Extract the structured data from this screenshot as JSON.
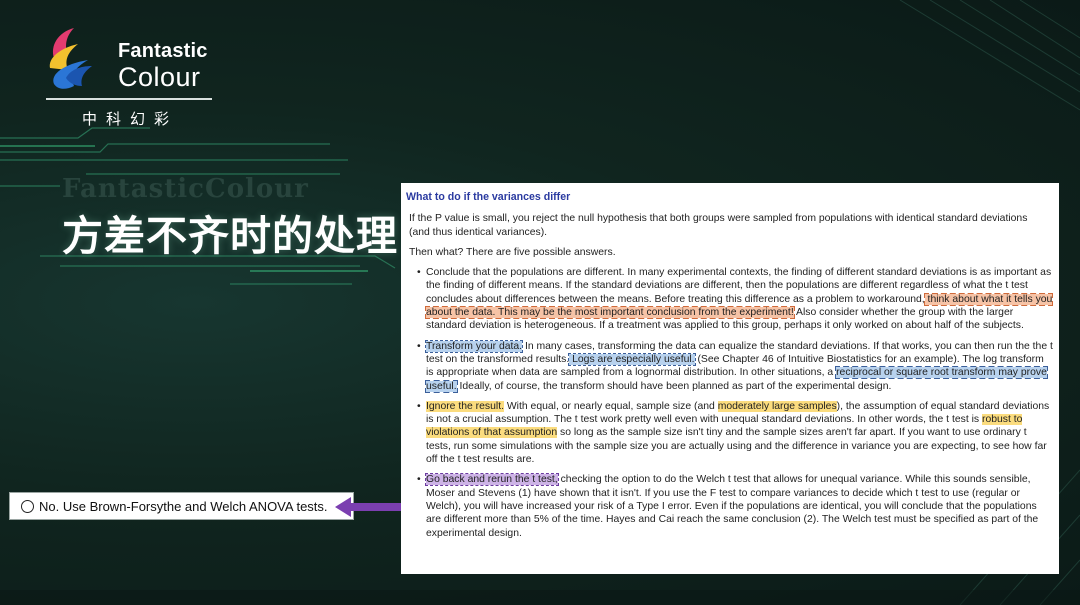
{
  "logo": {
    "name_line1": "Fantastic",
    "name_line2": "Colour",
    "name_cn": "中科幻彩"
  },
  "slide": {
    "ghost_text": "FantasticColour",
    "title": "方差不齐时的处理"
  },
  "note": {
    "text": "No. Use Brown-Forsythe and Welch ANOVA tests."
  },
  "panel": {
    "heading": "What to do if the variances differ",
    "para1": "If the P value is small, you reject the null hypothesis that both groups were sampled from populations with identical standard deviations (and thus identical variances).",
    "para2": "Then what? There are five possible answers.",
    "bullet": "•",
    "item1": {
      "t1": "Conclude that the populations are different. In many experimental contexts, the finding of different standard deviations is as important as the finding of different means. If the standard deviations are different, then the populations are different regardless of what the t test concludes about differences between the means. Before treating this difference as a problem to workaround,",
      "h1": " think about what it tells you about the data. This may be the most important conclusion from the experiment!",
      "t2": " Also consider whether the group with the larger standard deviation is heterogeneous. If a treatment was applied to this group, perhaps it only worked on about half of the subjects."
    },
    "item2": {
      "h1": "Transform your data.",
      "t1": " In many cases, transforming the data can equalize the standard deviations. If that works, you can then run the the t test on the transformed results.",
      "h2": " Logs are especially useful.",
      "t2": " (See Chapter 46 of Intuitive Biostatistics for an example). The log transform is appropriate when  data are sampled from a lognormal distribution. In other situations, a ",
      "h3": "reciprocal or square root transform may prove useful.",
      "t3": " Ideally, of course, the transform should have been planned as part of the experimental design."
    },
    "item3": {
      "h1": "Ignore the result.",
      "t1": " With equal, or nearly equal, sample size (and ",
      "h2": "moderately large samples",
      "t2": "), the assumption of equal standard deviations is not a crucial assumption. The t test  work pretty well even with unequal standard deviations. In other words, the t test is ",
      "h3": "robust to violations of that assumption",
      "t3": " so long as the sample size isn't tiny and the sample sizes aren't far apart. If you want to use ordinary t tests, run some simulations with the sample size you are actually using and the difference in variance you are expecting, to see how far off the t test results are."
    },
    "item4": {
      "h1": "Go back and rerun the t test,",
      "t1": " checking the option to do the Welch t test that allows for unequal variance. While this sounds sensible, Moser and Stevens (1) have shown that it isn't. If you use the F test to compare variances to decide which t test to use (regular or Welch), you will have increased your risk of a Type I error. Even if the populations are identical, you will conclude that the populations are different more than 5% of the time. Hayes and Cai reach the same conclusion (2). The Welch test must be specified as part of the experimental design."
    }
  },
  "colors": {
    "background": "#10251f",
    "accent_green": "#2fc07a",
    "heading_blue": "#2a3aa0",
    "arrow_purple": "#7b3fb0",
    "highlight_orange": "#f6c3a6",
    "highlight_blue": "#b8d2ee",
    "highlight_yellow": "#fbdc7e",
    "highlight_purple": "#cdb3e6"
  }
}
